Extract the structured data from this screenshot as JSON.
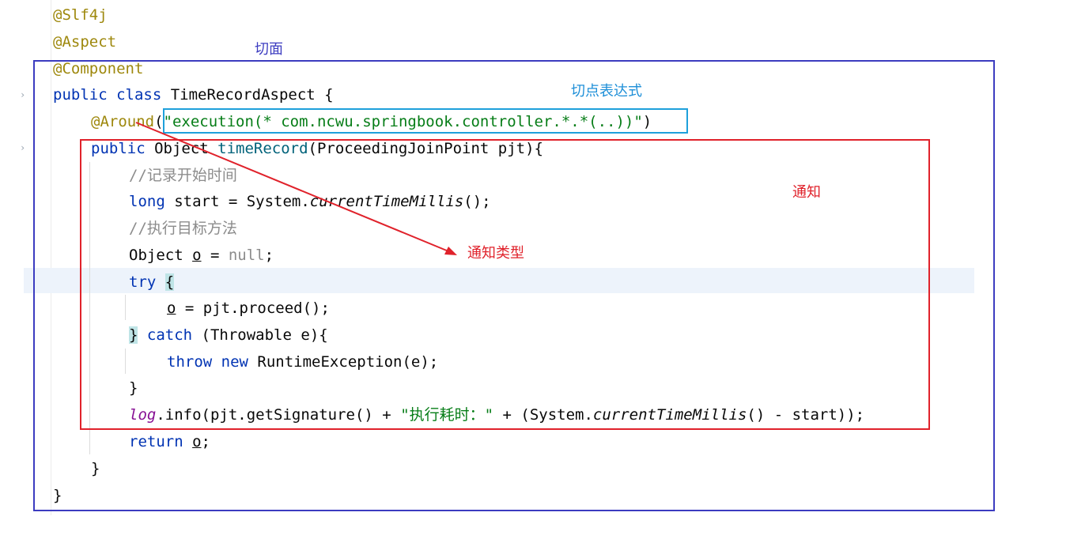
{
  "code": {
    "line1": "@Slf4j",
    "line2": "@Aspect",
    "line3": "@Component",
    "line4": {
      "kw": "public class",
      "name": " TimeRecordAspect {"
    },
    "line5": {
      "ann": "@Around",
      "open": "(",
      "str": "\"execution(* com.ncwu.springbook.controller.*.*(..))\"",
      "close": ")"
    },
    "line6": {
      "kw": "public",
      "type": " Object ",
      "fn": "timeRecord",
      "rest": "(ProceedingJoinPoint pjt){"
    },
    "line7": "//记录开始时间",
    "line8": {
      "kw": "long",
      "mid": " start = System.",
      "it": "currentTimeMillis",
      "end": "();"
    },
    "line9": "//执行目标方法",
    "line10": {
      "type": "Object ",
      "var": "o",
      "eq": " = ",
      "null": "null",
      "end": ";"
    },
    "line11": {
      "kw": "try",
      "space": " ",
      "brace": "{"
    },
    "line12": {
      "var": "o",
      "rest": " = pjt.proceed();"
    },
    "line13": {
      "brace": "}",
      "space": " ",
      "kw": "catch",
      "rest": " (Throwable e){"
    },
    "line14": {
      "kw1": "throw",
      "space": " ",
      "kw2": "new",
      "rest": " RuntimeException(e);"
    },
    "line15": "}",
    "line16": {
      "field": "log",
      "mid": ".info(pjt.getSignature() + ",
      "str": "\"执行耗时：\"",
      "mid2": " + (System.",
      "it": "currentTimeMillis",
      "end": "() - start));"
    },
    "line17": {
      "kw": "return",
      "space": " ",
      "var": "o",
      "end": ";"
    },
    "line18": "}",
    "line19": "}"
  },
  "annotations": {
    "aspect": "切面",
    "pointcut": "切点表达式",
    "advice": "通知",
    "advice_type": "通知类型"
  },
  "colors": {
    "aspect_box": "#3c3cc0",
    "pointcut_box": "#1ea0db",
    "advice_box": "#e0222b",
    "arrow": "#e0222b"
  }
}
